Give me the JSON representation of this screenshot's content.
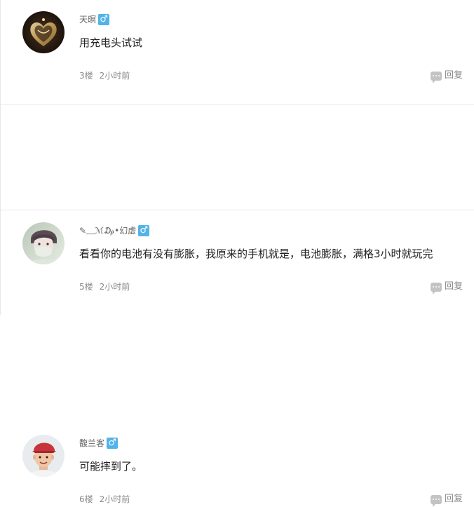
{
  "comments": [
    {
      "username": "天暝",
      "gender_icon": "male-icon",
      "text": "用充电头试试",
      "floor": "3楼",
      "time": "2小时前",
      "reply_label": "回复",
      "avatar": "heart-ornament-avatar"
    },
    {
      "username": "✎﹏ℳ₯•幻虚",
      "gender_icon": "male-icon",
      "text": "看看你的电池有没有膨胀，我原来的手机就是，电池膨胀，满格3小时就玩完",
      "floor": "5楼",
      "time": "2小时前",
      "reply_label": "回复",
      "avatar": "masked-person-avatar"
    },
    {
      "username": "馥兰客",
      "gender_icon": "male-icon",
      "text": "可能摔到了。",
      "floor": "6楼",
      "time": "2小时前",
      "reply_label": "回复",
      "avatar": "person-red-cap-avatar"
    }
  ],
  "colors": {
    "gender_badge": "#52b3e8",
    "text": "#222222",
    "meta": "#8a8a8a",
    "divider": "#e8e8e8"
  }
}
